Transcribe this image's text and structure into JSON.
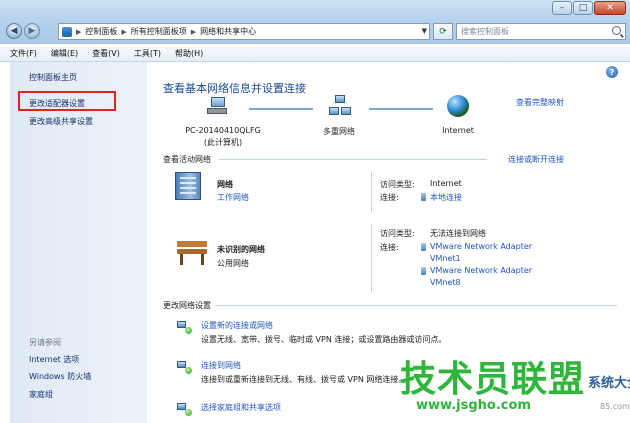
{
  "window": {
    "caption": {
      "minimize": "–",
      "maximize": "□",
      "close": "✕"
    },
    "address": {
      "crumbs": [
        "控制面板",
        "所有控制面板项",
        "网络和共享中心"
      ]
    },
    "search_placeholder": "搜索控制面板"
  },
  "menubar": {
    "items": [
      "文件(F)",
      "编辑(E)",
      "查看(V)",
      "工具(T)",
      "帮助(H)"
    ]
  },
  "left_pane": {
    "home": "控制面板主页",
    "adapter_settings": "更改适配器设置",
    "advanced_sharing": "更改高级共享设置",
    "see_also_title": "另请参阅",
    "see_also": [
      "Internet 选项",
      "Windows 防火墙",
      "家庭组"
    ]
  },
  "main": {
    "title": "查看基本网络信息并设置连接",
    "full_map_link": "查看完整映射",
    "map": {
      "computer_name": "PC-20140410QLFG",
      "computer_sub": "(此计算机)",
      "multi_network": "多重网络",
      "internet": "Internet"
    },
    "active_networks_title": "查看活动网络",
    "connect_link": "连接或断开连接",
    "networks": [
      {
        "name": "网络",
        "type": "工作网络",
        "access_label": "访问类型:",
        "access_value": "Internet",
        "conn_label": "连接:",
        "connections": [
          "本地连接"
        ]
      },
      {
        "name": "未识别的网络",
        "type": "公用网络",
        "access_label": "访问类型:",
        "access_value": "无法连接到网络",
        "conn_label": "连接:",
        "connections": [
          "VMware Network Adapter",
          "VMnet1",
          "VMware Network Adapter",
          "VMnet8"
        ]
      }
    ],
    "change_settings_title": "更改网络设置",
    "tasks": [
      {
        "link": "设置新的连接或网络",
        "desc": "设置无线、宽带、拨号、临时或 VPN 连接；或设置路由器或访问点。"
      },
      {
        "link": "连接到网络",
        "desc": "连接到或重新连接到无线、有线、拨号或 VPN 网络连接。"
      },
      {
        "link": "选择家庭组和共享选项",
        "desc": ""
      }
    ]
  },
  "watermark": {
    "brand": "技术员联盟",
    "side": "系统大全",
    "url": "www.jsgho.com",
    "url2": "85.com"
  },
  "colors": {
    "link": "#1f57c3",
    "title": "#1a4a96",
    "highlight_box": "#e02420",
    "watermark_green": "#2fb53c"
  }
}
